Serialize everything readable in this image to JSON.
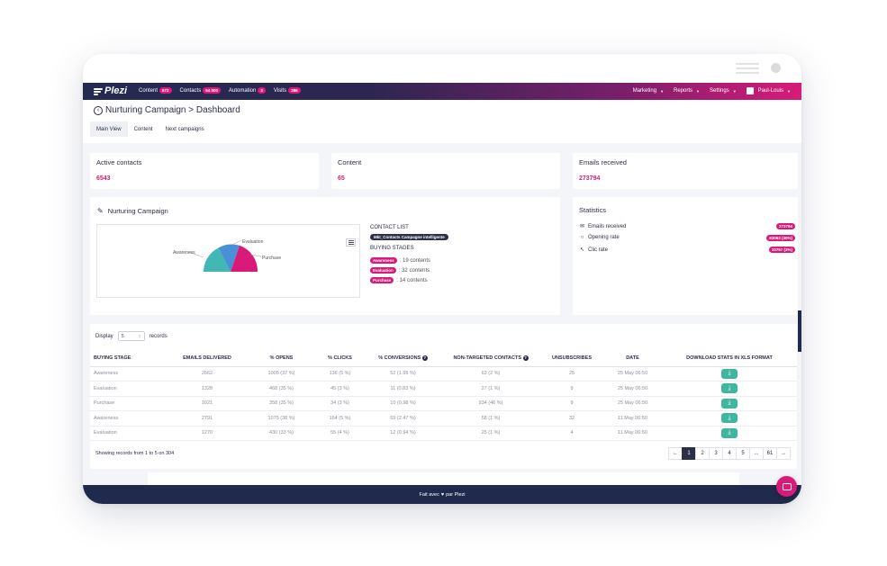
{
  "nav": {
    "logo": "Plezi",
    "items": [
      {
        "label": "Content",
        "badge": "672"
      },
      {
        "label": "Contacts",
        "badge": "64 000"
      },
      {
        "label": "Automation",
        "badge": "3"
      },
      {
        "label": "Visits",
        "badge": "386"
      }
    ],
    "right": [
      "Marketing",
      "Reports",
      "Settings"
    ],
    "user": "Paul-Louis"
  },
  "page": {
    "title": "Nurturing Campaign > Dashboard",
    "tabs": [
      "Main View",
      "Content",
      "Next campaigns"
    ]
  },
  "kpis": [
    {
      "label": "Active contacts",
      "value": "6543"
    },
    {
      "label": "Content",
      "value": "65"
    },
    {
      "label": "Emails received",
      "value": "273794"
    }
  ],
  "campaign": {
    "title": "Nurturing Campaign",
    "chart_labels": [
      "Awareness",
      "Evaluation",
      "Purchase"
    ],
    "contact_list_label": "CONTACT LIST",
    "contact_list": "Mkt_Contacts Campagne intelligente",
    "buying_stages_label": "BUYING STAGES",
    "stages": [
      {
        "name": "Awareness",
        "text": ": 19 contents"
      },
      {
        "name": "Evaluation",
        "text": ": 32 contents"
      },
      {
        "name": "Purchase",
        "text": ": 14 contents"
      }
    ]
  },
  "statistics": {
    "title": "Statistics",
    "rows": [
      {
        "label": "Emails received",
        "value": "273794",
        "icon": "envelope-icon"
      },
      {
        "label": "Opening rate",
        "value": "83063 (30%)",
        "icon": "circle-icon"
      },
      {
        "label": "Clic rate",
        "value": "10757 (3%)",
        "icon": "cursor-icon"
      }
    ]
  },
  "table": {
    "display_label": "Display",
    "display_value": "5",
    "records_label": "records",
    "headers": [
      "BUYING STAGE",
      "EMAILS DELIVERED",
      "% OPENS",
      "% CLICKS",
      "% CONVERSIONS",
      "NON-TARGETED CONTACTS",
      "UNSUBSCRIBES",
      "DATE",
      "DOWNLOAD STATS IN XLS FORMAT"
    ],
    "rows": [
      [
        "Awareness",
        "2662",
        "1005 (37 %)",
        "136 (5 %)",
        "52 (1.95 %)",
        "63 (2 %)",
        "25",
        "25 May 06:50"
      ],
      [
        "Evaluation",
        "1328",
        "468 (35 %)",
        "45 (3 %)",
        "11 (0.83 %)",
        "27 (1 %)",
        "9",
        "25 May 06:50"
      ],
      [
        "Purchase",
        "1021",
        "358 (35 %)",
        "34 (3 %)",
        "10 (0.98 %)",
        "934 (46 %)",
        "9",
        "25 May 06:50"
      ],
      [
        "Awareness",
        "2791",
        "1075 (38 %)",
        "164 (5 %)",
        "69 (2.47 %)",
        "58 (1 %)",
        "32",
        "11 May 06:50"
      ],
      [
        "Evaluation",
        "1270",
        "430 (33 %)",
        "55 (4 %)",
        "12 (0.94 %)",
        "25 (1 %)",
        "4",
        "11 May 06:50"
      ]
    ],
    "showing": "Showing records from 1 to 5 on 304",
    "pages": [
      "1",
      "2",
      "3",
      "4",
      "5",
      "...",
      "61"
    ]
  },
  "footer": {
    "left": "Fait avec",
    "right": "par Plezi"
  },
  "colors": {
    "brand_pink": "#d81b78",
    "navy": "#2b2f4a",
    "teal": "#3fb6a0",
    "chart_teal": "#41b8b3",
    "chart_blue": "#4a90d9"
  }
}
